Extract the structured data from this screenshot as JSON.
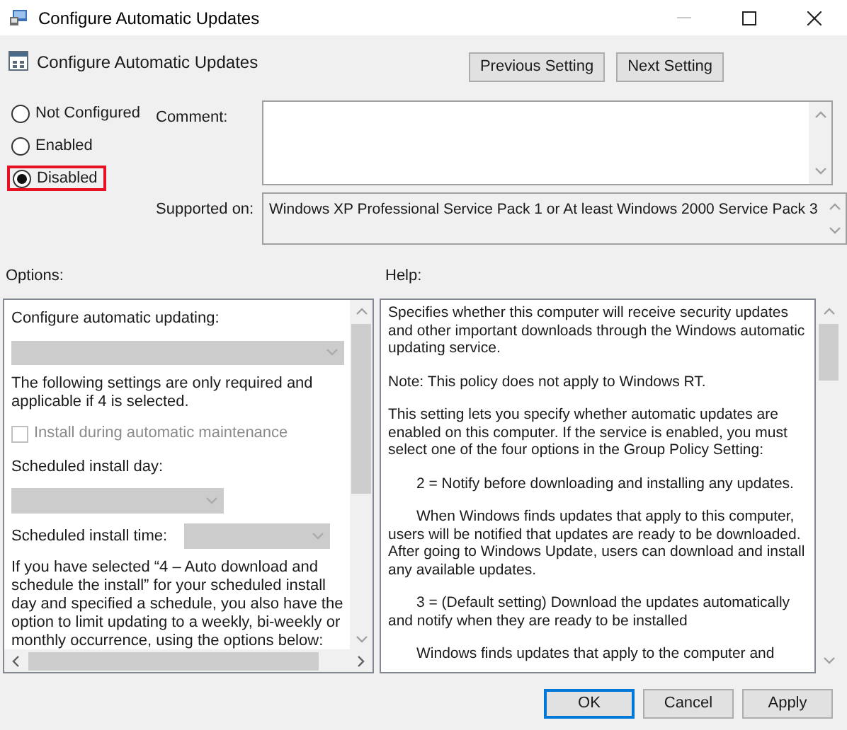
{
  "window": {
    "title": "Configure Automatic Updates"
  },
  "header": {
    "title": "Configure Automatic Updates",
    "buttons": [
      "Previous Setting",
      "Next Setting"
    ]
  },
  "state_options": [
    {
      "label": "Not Configured",
      "selected": false,
      "highlighted": false
    },
    {
      "label": "Enabled",
      "selected": false,
      "highlighted": false
    },
    {
      "label": "Disabled",
      "selected": true,
      "highlighted": true
    }
  ],
  "comment": {
    "label": "Comment:"
  },
  "supported_on": {
    "label": "Supported on:",
    "value": "Windows XP Professional Service Pack 1 or At least Windows 2000 Service Pack 3"
  },
  "options": {
    "label": "Options:",
    "items": [
      {
        "kind": "label",
        "text": "Configure automatic updating:"
      },
      {
        "kind": "dropdown",
        "disabled": true
      },
      {
        "kind": "text",
        "text": "The following settings are only required and applicable if 4 is selected."
      },
      {
        "kind": "checkbox",
        "text": "Install during automatic maintenance",
        "checked": false,
        "disabled": true
      },
      {
        "kind": "label",
        "text": "Scheduled install day:"
      },
      {
        "kind": "dropdown-small",
        "disabled": true
      },
      {
        "kind": "labeled-dropdown",
        "text": "Scheduled install time:",
        "disabled": true
      },
      {
        "kind": "text",
        "text": "If you have selected “4 – Auto download and schedule the install” for your scheduled install day and specified a schedule, you also have the option to limit updating to a weekly, bi-weekly or monthly occurrence, using the options below:"
      }
    ]
  },
  "help": {
    "label": "Help:",
    "paragraphs": [
      {
        "text": "Specifies whether this computer will receive security updates and other important downloads through the Windows automatic updating service.",
        "indent": false
      },
      {
        "text": "Note: This policy does not apply to Windows RT.",
        "indent": false
      },
      {
        "text": "This setting lets you specify whether automatic updates are enabled on this computer. If the service is enabled, you must select one of the four options in the Group Policy Setting:",
        "indent": false
      },
      {
        "text": "2 = Notify before downloading and installing any updates.",
        "indent": true
      },
      {
        "text": "When Windows finds updates that apply to this computer, users will be notified that updates are ready to be downloaded. After going to Windows Update, users can download and install any available updates.",
        "indent": true
      },
      {
        "text": "3 = (Default setting) Download the updates automatically and notify when they are ready to be installed",
        "indent": true
      },
      {
        "text": "Windows finds updates that apply to the computer and",
        "indent": true
      }
    ]
  },
  "footer": {
    "buttons": [
      {
        "label": "OK",
        "default": true
      },
      {
        "label": "Cancel",
        "default": false
      },
      {
        "label": "Apply",
        "default": false
      }
    ]
  }
}
